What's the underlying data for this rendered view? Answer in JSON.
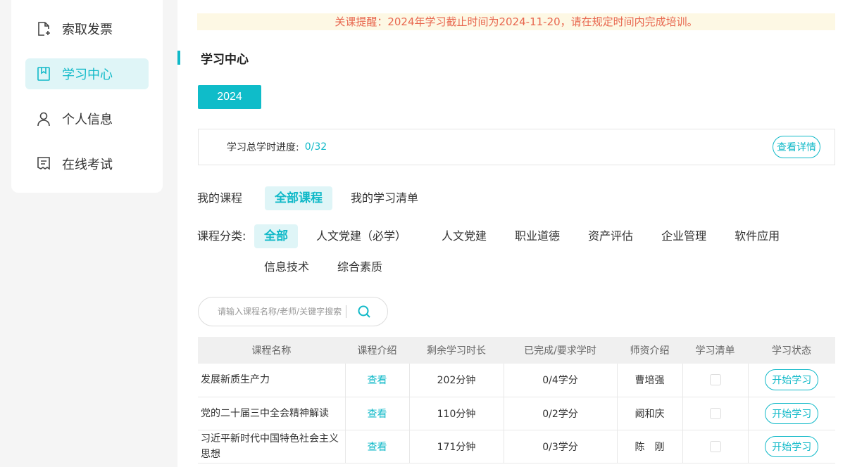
{
  "sidebar": {
    "items": [
      {
        "label": "索取发票",
        "icon": "invoice-icon",
        "active": false
      },
      {
        "label": "学习中心",
        "icon": "bookmark-book-icon",
        "active": true
      },
      {
        "label": "个人信息",
        "icon": "user-icon",
        "active": false
      },
      {
        "label": "在线考试",
        "icon": "exam-icon",
        "active": false
      }
    ]
  },
  "notice": "关课提醒：2024年学习截止时间为2024-11-20，请在规定时间内完成培训。",
  "section_title": "学习中心",
  "year": "2024",
  "progress": {
    "label": "学习总学时进度:",
    "value": "0/32",
    "detail_button": "查看详情"
  },
  "tabs": [
    {
      "label": "我的课程",
      "active": false
    },
    {
      "label": "全部课程",
      "active": true
    },
    {
      "label": "我的学习清单",
      "active": false
    }
  ],
  "categories": {
    "label": "课程分类:",
    "row1": [
      {
        "label": "全部",
        "active": true
      },
      {
        "label": "人文党建（必学）",
        "active": false
      },
      {
        "label": "人文党建",
        "active": false
      },
      {
        "label": "职业道德",
        "active": false
      },
      {
        "label": "资产评估",
        "active": false
      },
      {
        "label": "企业管理",
        "active": false
      },
      {
        "label": "软件应用",
        "active": false
      }
    ],
    "row2": [
      {
        "label": "信息技术",
        "active": false
      },
      {
        "label": "综合素质",
        "active": false
      }
    ]
  },
  "search": {
    "placeholder": "请输入课程名称/老师/关键字搜索"
  },
  "table": {
    "headers": [
      "课程名称",
      "课程介绍",
      "剩余学习时长",
      "已完成/要求学时",
      "师资介绍",
      "学习清单",
      "学习状态"
    ],
    "rows": [
      {
        "name": "发展新质生产力",
        "intro": "查看",
        "remaining": "202分钟",
        "progress": "0/4学分",
        "teacher": "曹培强",
        "action": "开始学习"
      },
      {
        "name": "党的二十届三中全会精神解读",
        "intro": "查看",
        "remaining": "110分钟",
        "progress": "0/2学分",
        "teacher": "阚和庆",
        "action": "开始学习"
      },
      {
        "name": "习近平新时代中国特色社会主义思想",
        "intro": "查看",
        "remaining": "171分钟",
        "progress": "0/3学分",
        "teacher": "陈　刚",
        "action": "开始学习"
      }
    ]
  },
  "colors": {
    "accent": "#10b9c8",
    "notice_text": "#e8664e",
    "notice_bg": "#fdf8e4"
  }
}
